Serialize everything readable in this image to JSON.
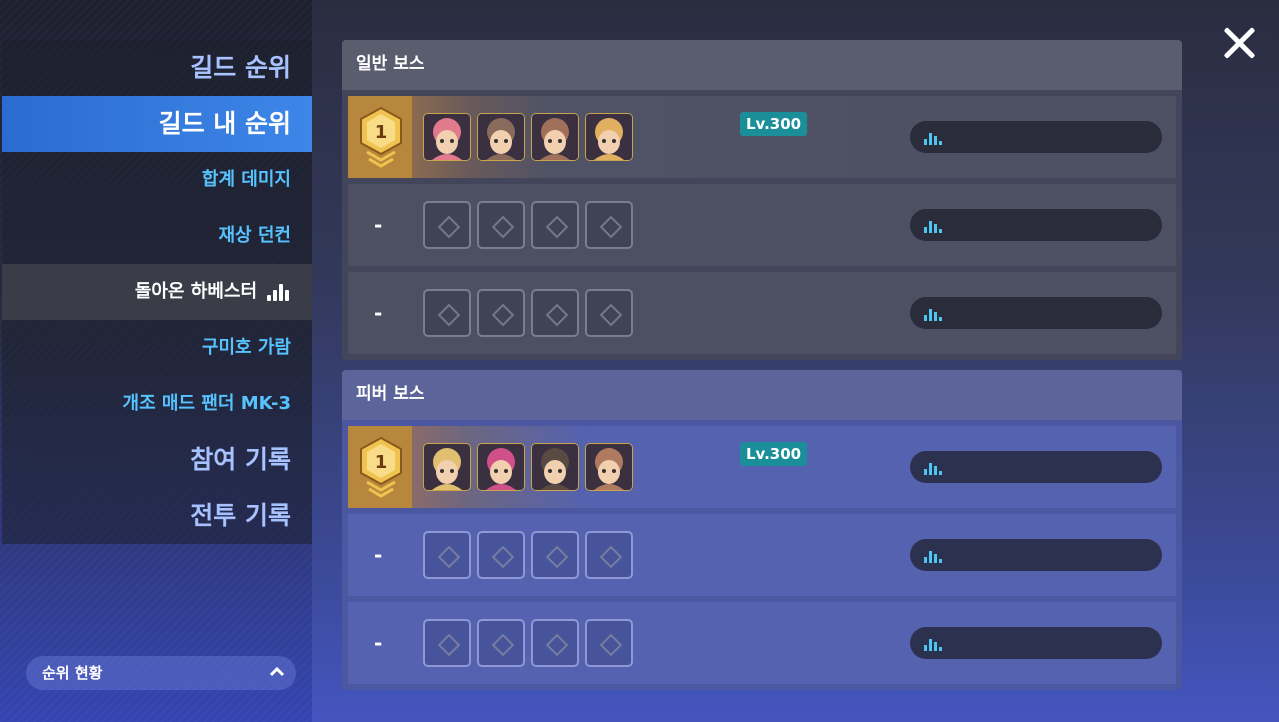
{
  "sidebar": {
    "items": [
      {
        "label": "길드 순위",
        "style": "big"
      },
      {
        "label": "길드 내 순위",
        "style": "big-active"
      },
      {
        "label": "합계 데미지",
        "style": "sub"
      },
      {
        "label": "재상 던컨",
        "style": "sub"
      },
      {
        "label": "돌아온 하베스터",
        "style": "sub-selected"
      },
      {
        "label": "구미호 가람",
        "style": "sub"
      },
      {
        "label": "개조 매드 팬더 MK-3",
        "style": "sub"
      },
      {
        "label": "참여 기록",
        "style": "big"
      },
      {
        "label": "전투 기록",
        "style": "big"
      }
    ],
    "rank_toggle": {
      "label": "순위 현황",
      "icon": "chevron-up-icon"
    }
  },
  "close_icon": "close-icon",
  "panels": [
    {
      "title": "일반 보스",
      "rows": [
        {
          "rank": "1",
          "level": "Lv.300",
          "heroes": [
            "#e07a8c",
            "#8a6a5a",
            "#a0705a",
            "#e0b060"
          ]
        },
        {
          "rank": "-",
          "level": "",
          "heroes": []
        },
        {
          "rank": "-",
          "level": "",
          "heroes": []
        }
      ]
    },
    {
      "title": "피버 보스",
      "rows": [
        {
          "rank": "1",
          "level": "Lv.300",
          "heroes": [
            "#e0c070",
            "#d0508a",
            "#5a4a44",
            "#b07a60"
          ]
        },
        {
          "rank": "-",
          "level": "",
          "heroes": []
        },
        {
          "rank": "-",
          "level": "",
          "heroes": []
        }
      ]
    }
  ],
  "colors": {
    "accent": "#3d86e8",
    "level_badge": "#1a8f9a",
    "medal": "#e2a93c",
    "score_bars": "#4ec4f0"
  }
}
